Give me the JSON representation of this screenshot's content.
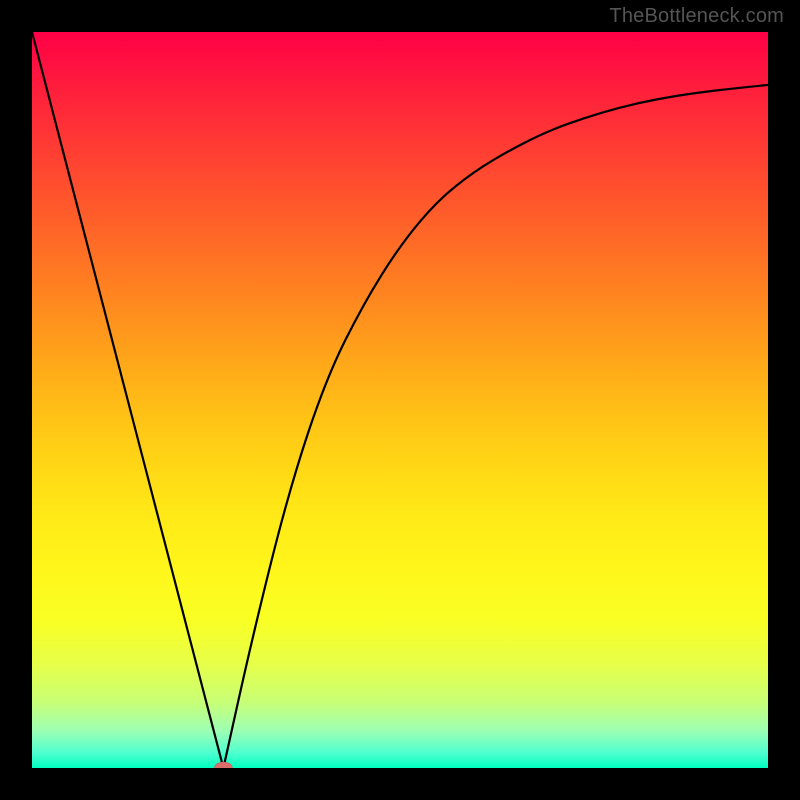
{
  "watermark": "TheBottleneck.com",
  "chart_data": {
    "type": "line",
    "title": "",
    "xlabel": "",
    "ylabel": "",
    "xlim": [
      0,
      100
    ],
    "ylim": [
      0,
      100
    ],
    "grid": false,
    "legend": false,
    "series": [
      {
        "name": "curve",
        "x": [
          0,
          26,
          30,
          35,
          40,
          45,
          50,
          55,
          60,
          65,
          70,
          75,
          80,
          85,
          90,
          95,
          100
        ],
        "y": [
          100,
          0,
          18,
          38,
          53,
          63,
          71,
          77,
          81,
          84,
          86.5,
          88.3,
          89.8,
          90.9,
          91.7,
          92.3,
          92.8
        ]
      }
    ],
    "marker": {
      "x": 26,
      "y": 0
    },
    "background_gradient": {
      "direction": "vertical",
      "stops": [
        {
          "pos": 0,
          "color": "#ff0046"
        },
        {
          "pos": 16,
          "color": "#ff3d33"
        },
        {
          "pos": 31,
          "color": "#ff7324"
        },
        {
          "pos": 45,
          "color": "#ffa819"
        },
        {
          "pos": 59,
          "color": "#ffd715"
        },
        {
          "pos": 73,
          "color": "#fff61b"
        },
        {
          "pos": 86,
          "color": "#e6ff4a"
        },
        {
          "pos": 95,
          "color": "#9cffb5"
        },
        {
          "pos": 100,
          "color": "#00ffc0"
        }
      ]
    }
  }
}
